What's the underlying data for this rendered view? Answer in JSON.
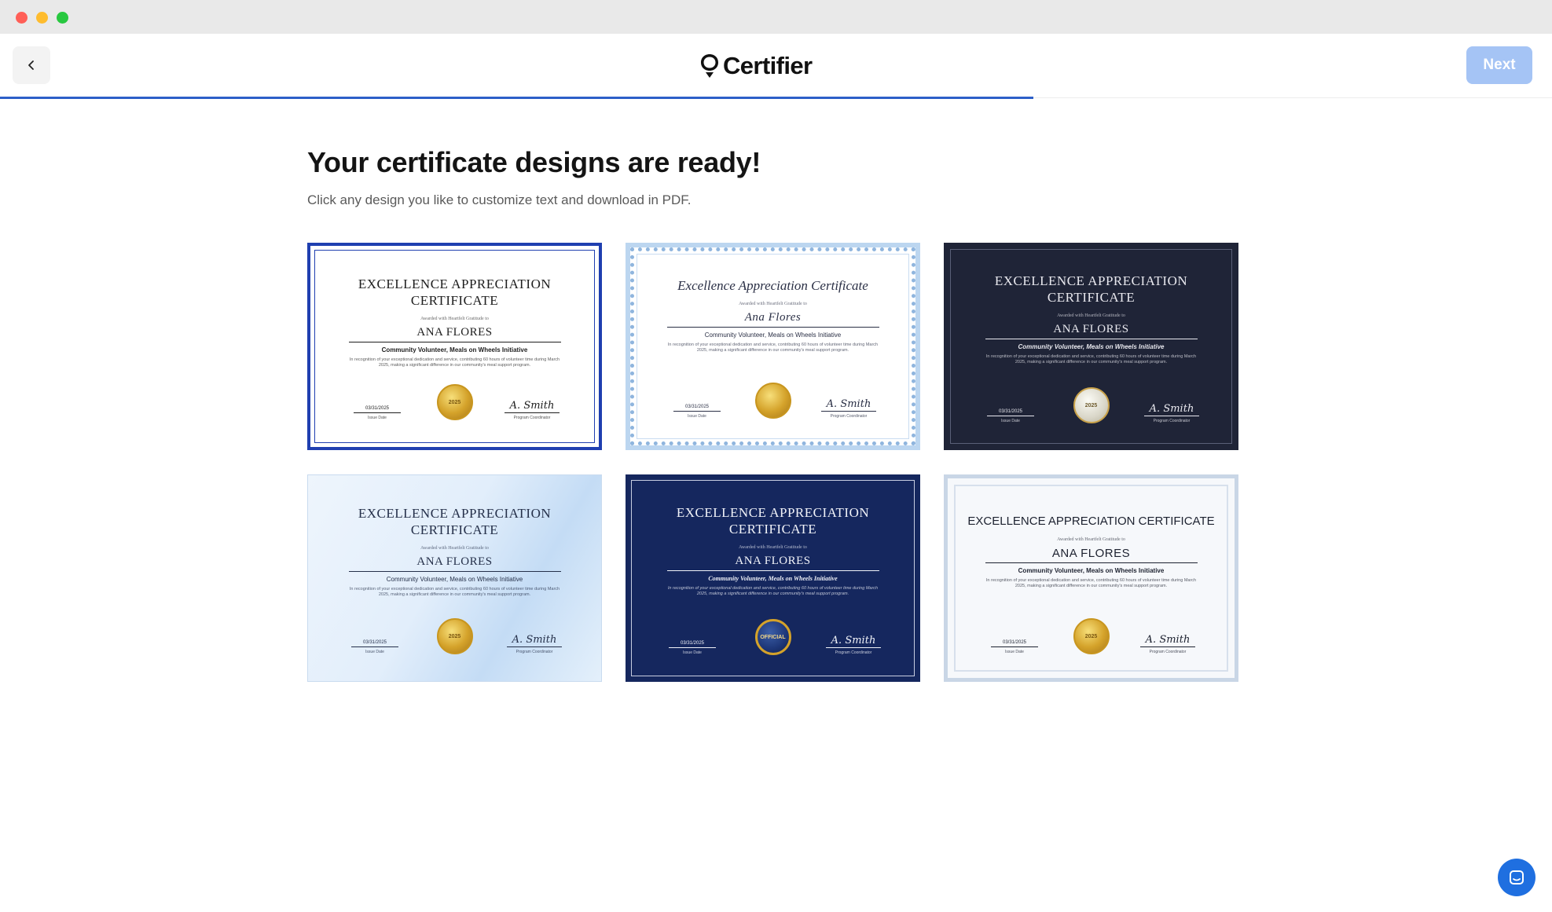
{
  "app": {
    "name": "Certifier"
  },
  "header": {
    "next_label": "Next"
  },
  "main": {
    "heading": "Your certificate designs are ready!",
    "subheading": "Click any design you like to customize text and download in PDF."
  },
  "designs": [
    {
      "title": "EXCELLENCE APPRECIATION CERTIFICATE",
      "awarded": "Awarded with Heartfelt Gratitude to",
      "recipient": "ANA FLORES",
      "role": "Community Volunteer, Meals on Wheels Initiative",
      "description": "In recognition of your exceptional dedication and service, contributing 60 hours of volunteer time during March 2025, making a significant difference in our community's meal support program.",
      "date": "03/31/2025",
      "date_label": "Issue Date",
      "signature": "A. Smith",
      "signer_label": "Program Coordinator",
      "seal": "2025"
    },
    {
      "title": "Excellence Appreciation Certificate",
      "awarded": "Awarded with Heartfelt Gratitude to",
      "recipient": "Ana Flores",
      "role": "Community Volunteer, Meals on Wheels Initiative",
      "description": "In recognition of your exceptional dedication and service, contributing 60 hours of volunteer time during March 2025, making a significant difference in our community's meal support program.",
      "date": "03/31/2025",
      "date_label": "Issue Date",
      "signature": "A. Smith",
      "signer_label": "Program Coordinator",
      "seal": ""
    },
    {
      "title": "EXCELLENCE APPRECIATION CERTIFICATE",
      "awarded": "Awarded with Heartfelt Gratitude to",
      "recipient": "ANA FLORES",
      "role": "Community Volunteer, Meals on Wheels Initiative",
      "description": "In recognition of your exceptional dedication and service, contributing 60 hours of volunteer time during March 2025, making a significant difference in our community's meal support program.",
      "date": "03/31/2025",
      "date_label": "Issue Date",
      "signature": "A. Smith",
      "signer_label": "Program Coordinator",
      "seal": "2025"
    },
    {
      "title": "EXCELLENCE APPRECIATION CERTIFICATE",
      "awarded": "Awarded with Heartfelt Gratitude to",
      "recipient": "ANA FLORES",
      "role": "Community Volunteer, Meals on Wheels Initiative",
      "description": "In recognition of your exceptional dedication and service, contributing 60 hours of volunteer time during March 2025, making a significant difference in our community's meal support program.",
      "date": "03/31/2025",
      "date_label": "Issue Date",
      "signature": "A. Smith",
      "signer_label": "Program Coordinator",
      "seal": "2025"
    },
    {
      "title": "EXCELLENCE APPRECIATION CERTIFICATE",
      "awarded": "Awarded with Heartfelt Gratitude to",
      "recipient": "ANA FLORES",
      "role": "Community Volunteer, Meals on Wheels Initiative",
      "description": "In recognition of your exceptional dedication and service, contributing 60 hours of volunteer time during March 2025, making a significant difference in our community's meal support program.",
      "date": "03/31/2025",
      "date_label": "Issue Date",
      "signature": "A. Smith",
      "signer_label": "Program Coordinator",
      "seal": "OFFICIAL"
    },
    {
      "title": "EXCELLENCE APPRECIATION CERTIFICATE",
      "awarded": "Awarded with Heartfelt Gratitude to",
      "recipient": "ANA FLORES",
      "role": "Community Volunteer, Meals on Wheels Initiative",
      "description": "In recognition of your exceptional dedication and service, contributing 60 hours of volunteer time during March 2025, making a significant difference in our community's meal support program.",
      "date": "03/31/2025",
      "date_label": "Issue Date",
      "signature": "A. Smith",
      "signer_label": "Program Coordinator",
      "seal": "2025"
    }
  ],
  "colors": {
    "accent": "#2d5fc8",
    "next_disabled": "#a5c4f5",
    "chat": "#1f6fe0"
  },
  "progress": {
    "fraction": 0.666
  },
  "icons": {
    "back": "chevron-left-icon",
    "logo": "certifier-logo-icon",
    "chat": "chat-icon"
  }
}
